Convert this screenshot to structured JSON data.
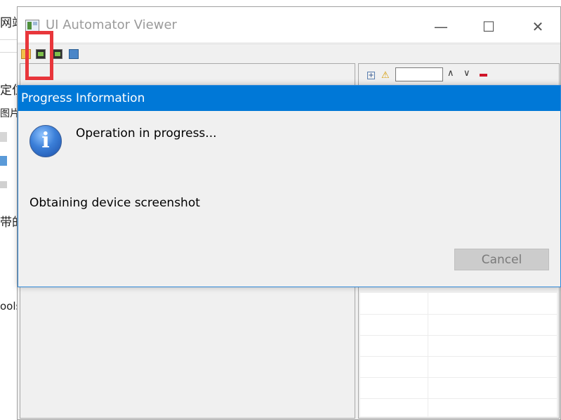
{
  "background_app": {
    "fragments": [
      "网站",
      "定位",
      "图片",
      "带的",
      "ools"
    ]
  },
  "window": {
    "title": "UI Automator Viewer",
    "controls": {
      "minimize": "—",
      "maximize": "☐",
      "close": "✕"
    },
    "toolbar": {
      "icons": [
        "open-icon",
        "device-screenshot-icon",
        "device-screenshot-compressed-icon",
        "save-icon"
      ]
    },
    "right_pane": {
      "expand_glyph": "+",
      "warning_glyph": "⚠",
      "up_glyph": "∧",
      "down_glyph": "∨",
      "search_value": ""
    }
  },
  "dialog": {
    "title": "Progress Information",
    "icon_glyph": "i",
    "heading": "Operation in progress...",
    "task": "Obtaining device screenshot",
    "cancel_label": "Cancel"
  },
  "colors": {
    "dialog_title_bar": "#0078d7",
    "highlight": "#e8363b",
    "window_bg": "#f0f0f0"
  }
}
